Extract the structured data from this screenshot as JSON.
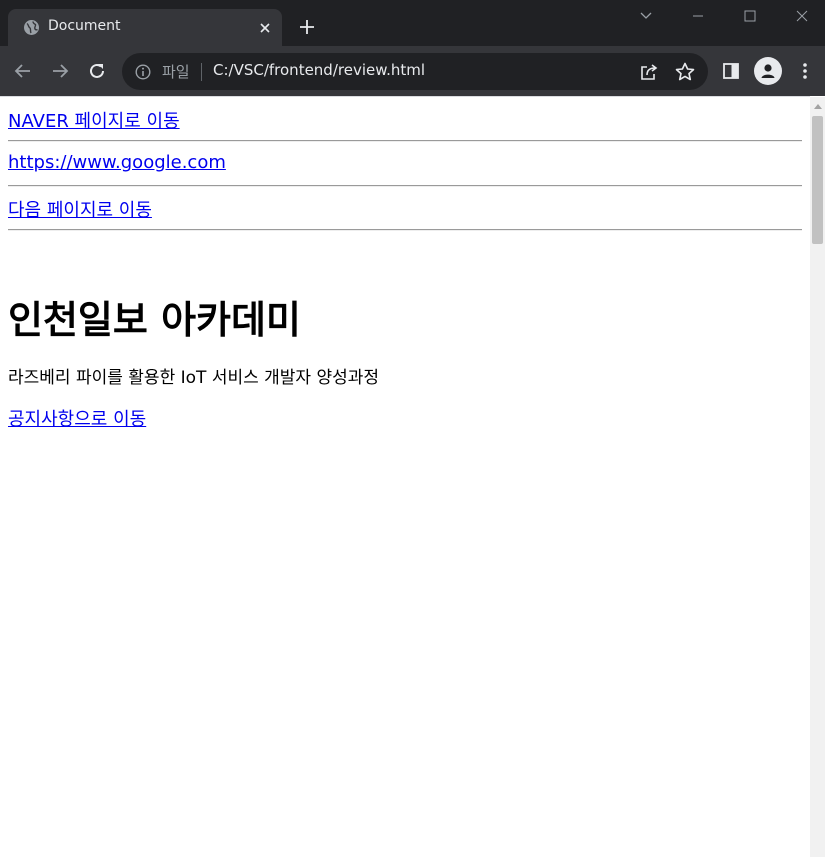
{
  "browser": {
    "tab": {
      "title": "Document"
    },
    "omnibox": {
      "scheme_label": "파일",
      "url": "C:/VSC/frontend/review.html"
    },
    "colors": {
      "frame": "#202124",
      "toolbar": "#35363a",
      "text": "#e8eaed",
      "muted": "#9aa0a6"
    }
  },
  "page": {
    "links": [
      {
        "text": "NAVER 페이지로 이동"
      },
      {
        "text": "https://www.google.com"
      },
      {
        "text": "다음 페이지로 이동"
      }
    ],
    "heading": "인천일보 아카데미",
    "paragraph": "라즈베리 파이를 활용한 IoT 서비스 개발자 양성과정",
    "notice_link": "공지사항으로 이동",
    "colors": {
      "link": "#0000ee",
      "text": "#000000"
    }
  },
  "icons": {
    "tab_favicon": "globe-icon",
    "tab_close": "close-icon",
    "new_tab": "plus-icon",
    "tab_search": "chevron-down-icon",
    "minimize": "minimize-icon",
    "maximize": "maximize-icon",
    "window_close": "close-icon",
    "back": "arrow-left-icon",
    "forward": "arrow-right-icon",
    "reload": "reload-icon",
    "site_info": "info-icon",
    "share": "share-icon",
    "bookmark": "star-icon",
    "side_panel": "side-panel-icon",
    "profile": "person-icon",
    "menu": "kebab-menu-icon"
  }
}
